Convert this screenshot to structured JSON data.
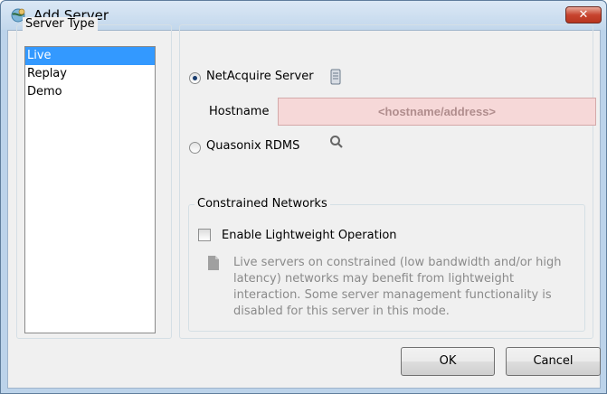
{
  "window": {
    "title": "Add Server",
    "close_label": "✕"
  },
  "server_type": {
    "legend": "Server Type",
    "items": [
      {
        "label": "Live",
        "selected": true
      },
      {
        "label": "Replay",
        "selected": false
      },
      {
        "label": "Demo",
        "selected": false
      }
    ]
  },
  "server_options": {
    "netacquire": {
      "label": "NetAcquire Server",
      "checked": true
    },
    "hostname_label": "Hostname",
    "hostname_placeholder": "<hostname/address>",
    "quasonix": {
      "label": "Quasonix RDMS",
      "checked": false
    }
  },
  "constrained": {
    "legend": "Constrained Networks",
    "checkbox_label": "Enable Lightweight Operation",
    "checked": false,
    "note": "Live servers on constrained (low bandwidth and/or high latency) networks may benefit from lightweight interaction. Some server management functionality is disabled for this server in this mode."
  },
  "buttons": {
    "ok": "OK",
    "cancel": "Cancel"
  },
  "colors": {
    "selection": "#3399ff",
    "hostname_bg": "#f6d8d8",
    "close_button": "#c7442f"
  },
  "icons": {
    "app": "globe-network-icon",
    "netacquire": "server-device-icon",
    "quasonix": "search-tool-icon",
    "note": "info-icon"
  }
}
